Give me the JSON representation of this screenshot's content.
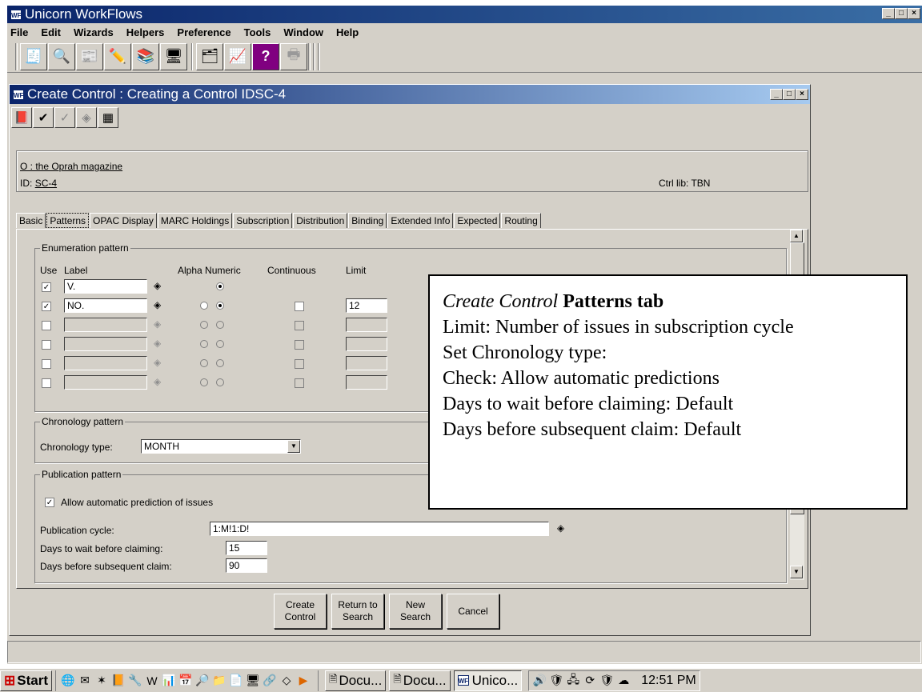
{
  "app": {
    "title": "Unicorn WorkFlows",
    "icon": "WF"
  },
  "menu": [
    "File",
    "Edit",
    "Wizards",
    "Helpers",
    "Preference",
    "Tools",
    "Window",
    "Help"
  ],
  "dialog": {
    "title": "Create Control : Creating a Control IDSC-4",
    "info_title": "O : the Oprah magazine",
    "id_label": "ID:",
    "id_value": "SC-4",
    "ctrl_lib": "Ctrl lib: TBN",
    "tabs": [
      "Basic",
      "Patterns",
      "OPAC Display",
      "MARC Holdings",
      "Subscription",
      "Distribution",
      "Binding",
      "Extended Info",
      "Expected",
      "Routing"
    ],
    "active_tab": "Patterns",
    "enumeration": {
      "legend": "Enumeration pattern",
      "col_use": "Use",
      "col_label": "Label",
      "col_alpha_numeric": "Alpha Numeric",
      "col_continuous": "Continuous",
      "col_limit": "Limit",
      "rows": [
        {
          "use": true,
          "label": "V.",
          "limit": ""
        },
        {
          "use": true,
          "label": "NO.",
          "limit": "12"
        },
        {
          "use": false,
          "label": "",
          "limit": ""
        },
        {
          "use": false,
          "label": "",
          "limit": ""
        },
        {
          "use": false,
          "label": "",
          "limit": ""
        },
        {
          "use": false,
          "label": "",
          "limit": ""
        }
      ]
    },
    "chronology": {
      "legend": "Chronology pattern",
      "type_label": "Chronology type:",
      "type_value": "MONTH"
    },
    "publication": {
      "legend": "Publication pattern",
      "auto_predict_label": "Allow automatic prediction of issues",
      "auto_predict": true,
      "cycle_label": "Publication cycle:",
      "cycle_value": "1:M!1:D!",
      "wait_label": "Days to wait before claiming:",
      "wait_value": "15",
      "subsequent_label": "Days before subsequent claim:",
      "subsequent_value": "90"
    },
    "buttons": {
      "create_1": "Create",
      "create_2": "Control",
      "return_1": "Return to",
      "return_2": "Search",
      "new_1": "New",
      "new_2": "Search",
      "cancel": "Cancel"
    }
  },
  "callout": {
    "title_italic": "Create Control",
    "title_bold": "Patterns tab",
    "lines": [
      "Limit: Number of issues in subscription cycle",
      "Set Chronology type:",
      "Check: Allow automatic predictions",
      "Days to wait before claiming: Default",
      "Days before subsequent claim:  Default"
    ]
  },
  "taskbar": {
    "start": "Start",
    "items": [
      "Docu...",
      "Docu...",
      "Unico..."
    ],
    "clock": "12:51 PM"
  }
}
